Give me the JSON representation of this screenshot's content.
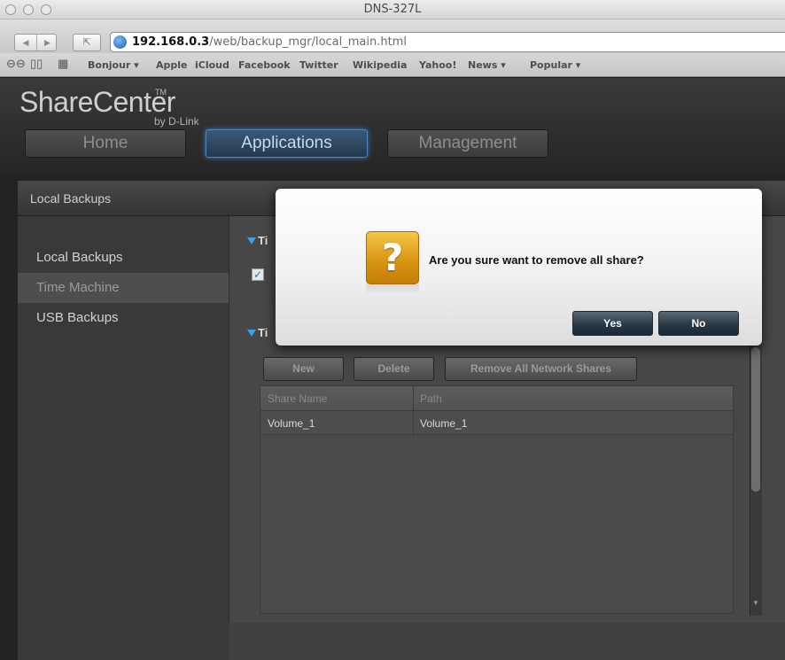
{
  "window": {
    "title": "DNS-327L"
  },
  "browser": {
    "url_host": "192.168.0.3",
    "url_path": "/web/backup_mgr/local_main.html",
    "bookmarks": [
      "Bonjour ▾",
      "Apple",
      "iCloud",
      "Facebook",
      "Twitter",
      "Wikipedia",
      "Yahoo!",
      "News ▾",
      "Popular ▾"
    ]
  },
  "app": {
    "logo": "ShareCenter",
    "logo_tm": "TM",
    "logo_by": "by D-Link",
    "nav_tabs": [
      "Home",
      "Applications",
      "Management"
    ],
    "active_tab": "Applications"
  },
  "panel": {
    "title": "Local Backups",
    "sidebar": [
      "Local Backups",
      "Time Machine",
      "USB Backups"
    ],
    "selected": "Time Machine"
  },
  "content": {
    "section1_head": "Ti",
    "section2_head": "Ti",
    "buttons": [
      "New",
      "Delete",
      "Remove All Network Shares"
    ],
    "table": {
      "columns": [
        "Share Name",
        "Path"
      ],
      "rows": [
        [
          "Volume_1",
          "Volume_1"
        ]
      ]
    }
  },
  "dialog": {
    "message": "Are you sure want to remove all share?",
    "icon": "question-icon",
    "icon_glyph": "?",
    "yes_label": "Yes",
    "no_label": "No"
  },
  "colors": {
    "accent_blue": "#3ea0e8",
    "dialog_button": "#2a3946",
    "question_icon": "#d79311"
  }
}
